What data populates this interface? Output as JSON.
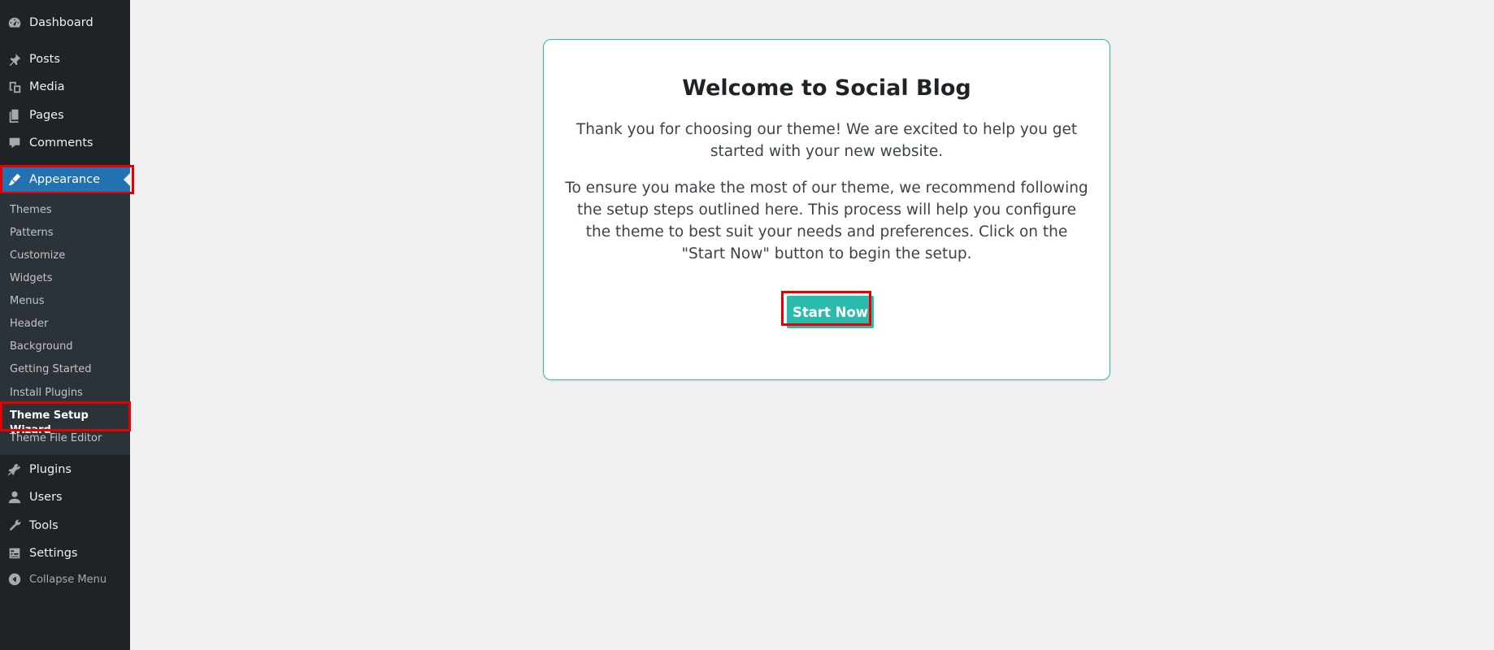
{
  "sidebar": {
    "items": [
      {
        "label": "Dashboard",
        "icon": "dashboard-icon"
      },
      {
        "label": "Posts",
        "icon": "pin-icon"
      },
      {
        "label": "Media",
        "icon": "media-icon"
      },
      {
        "label": "Pages",
        "icon": "pages-icon"
      },
      {
        "label": "Comments",
        "icon": "comment-icon"
      },
      {
        "label": "Appearance",
        "icon": "brush-icon"
      },
      {
        "label": "Plugins",
        "icon": "plugin-icon"
      },
      {
        "label": "Users",
        "icon": "user-icon"
      },
      {
        "label": "Tools",
        "icon": "wrench-icon"
      },
      {
        "label": "Settings",
        "icon": "settings-icon"
      },
      {
        "label": "Collapse Menu",
        "icon": "collapse-icon"
      }
    ],
    "submenu": [
      "Themes",
      "Patterns",
      "Customize",
      "Widgets",
      "Menus",
      "Header",
      "Background",
      "Getting Started",
      "Install Plugins",
      "Theme Setup Wizard",
      "Theme File Editor"
    ],
    "active_item": "Appearance",
    "current_subitem": "Theme Setup Wizard"
  },
  "card": {
    "title": "Welcome to Social Blog",
    "paragraph1": "Thank you for choosing our theme! We are excited to help you get started with your new website.",
    "paragraph2": "To ensure you make the most of our theme, we recommend following the setup steps outlined here. This process will help you configure the theme to best suit your needs and preferences. Click on the \"Start Now\" button to begin the setup.",
    "button_label": "Start Now"
  },
  "colors": {
    "sidebar_bg": "#1d2327",
    "submenu_bg": "#2c3338",
    "active_bg": "#2271b1",
    "accent": "#2bbbad",
    "highlight": "#e60000",
    "page_bg": "#f0f0f1"
  }
}
